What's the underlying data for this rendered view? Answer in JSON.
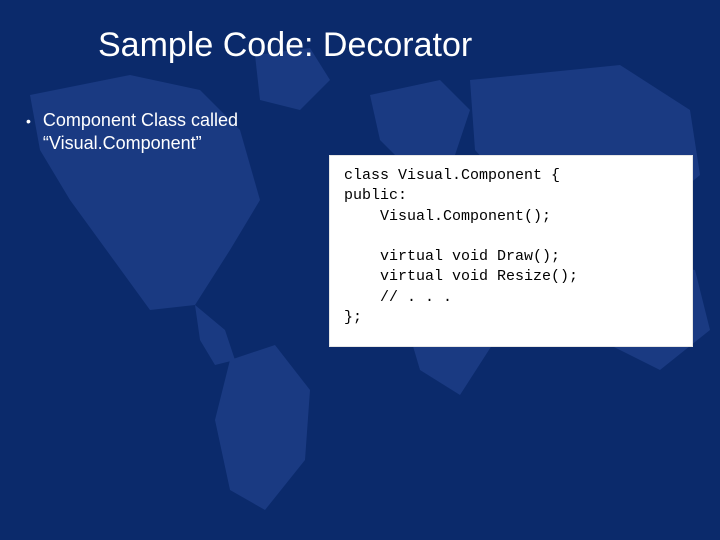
{
  "slide": {
    "title": "Sample Code: Decorator",
    "bullet": "Component Class called “Visual.Component”",
    "code": "class Visual.Component {\npublic:\n    Visual.Component();\n\n    virtual void Draw();\n    virtual void Resize();\n    // . . .\n};"
  }
}
